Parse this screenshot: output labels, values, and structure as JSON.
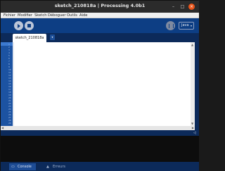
{
  "window": {
    "title": "sketch_210818a | Processing 4.0b1"
  },
  "window_controls": {
    "minimize": "–",
    "maximize": "□",
    "close": "×"
  },
  "menu": [
    "Fichier",
    "Modifier",
    "Sketch",
    "Déboguer",
    "Outils",
    "Aide"
  ],
  "toolbar": {
    "mode_label": "Java",
    "mode_caret": "▾"
  },
  "tabs": [
    {
      "label": "sketch_210818a",
      "active": true
    }
  ],
  "tab_menu_icon": "▾",
  "editor": {
    "line_numbers": [
      "1",
      "2",
      "3",
      "4",
      "5",
      "6",
      "7",
      "8",
      "9",
      "10",
      "11",
      "12",
      "13",
      "14",
      "15",
      "16",
      "17",
      "18",
      "19",
      "20",
      "21",
      "22",
      "23",
      "24",
      "25",
      "26",
      "27",
      "28",
      "29"
    ],
    "code": ""
  },
  "footer": {
    "console_label": "Console",
    "errors_label": "Erreurs",
    "console_icon": "▭",
    "errors_icon": "▲"
  },
  "colors": {
    "toolbar": "#0d3e84",
    "editor_bg": "#ffffff",
    "gutter": "#1c53a2",
    "console_bg": "#0d0d0d",
    "close_button": "#e9541a"
  }
}
